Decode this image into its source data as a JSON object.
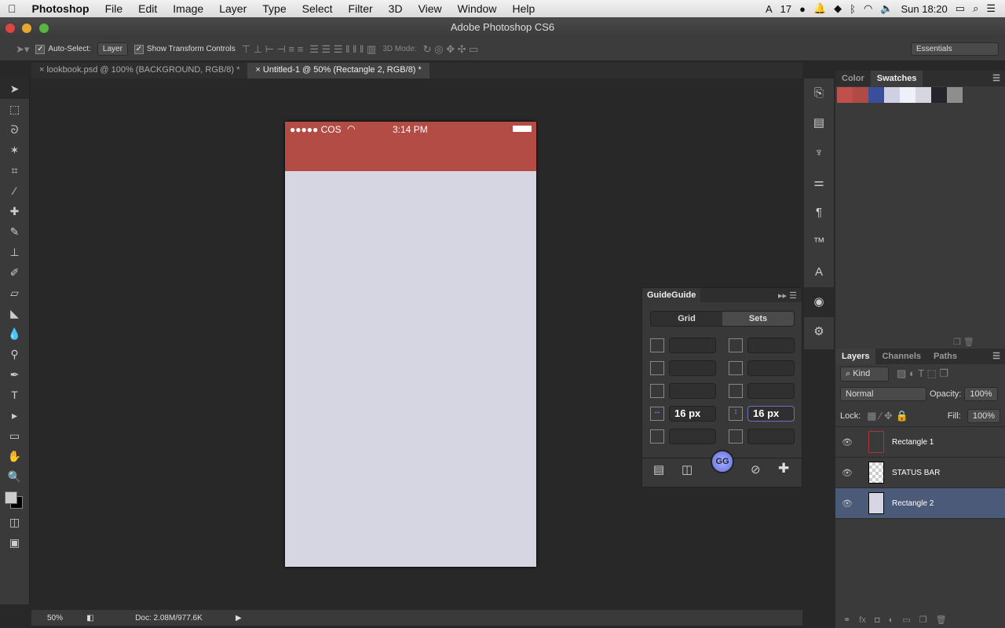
{
  "menubar": {
    "app": "Photoshop",
    "items": [
      "File",
      "Edit",
      "Image",
      "Layer",
      "Type",
      "Select",
      "Filter",
      "3D",
      "View",
      "Window",
      "Help"
    ],
    "status_17": "17",
    "clock": "Sun 18:20"
  },
  "window": {
    "title": "Adobe Photoshop CS6"
  },
  "options": {
    "auto_select": "Auto-Select:",
    "auto_select_value": "Layer",
    "show_transform": "Show Transform Controls",
    "mode_3d": "3D Mode:",
    "workspace": "Essentials"
  },
  "tabs": [
    {
      "label": "lookbook.psd @ 100% (BACKGROUND, RGB/8) *"
    },
    {
      "label": "Untitled-1 @ 50% (Rectangle 2, RGB/8) *"
    }
  ],
  "doc": {
    "carrier": "●●●●● COS",
    "time": "3:14 PM",
    "nav_color": "#b24c45",
    "body_color": "#d6d5e2"
  },
  "status": {
    "zoom": "50%",
    "doc_size": "Doc: 2.08M/977.6K"
  },
  "swatch_panel": {
    "tabs": [
      "Color",
      "Swatches"
    ],
    "swatches": [
      "#c0504a",
      "#b04a45",
      "#3a4f9a",
      "#d0d0e4",
      "#f0f0fa",
      "#d6d6e0",
      "#24242c",
      "#8e8e8e"
    ]
  },
  "guideguide": {
    "title": "GuideGuide",
    "tabs": [
      "Grid",
      "Sets"
    ],
    "col_gutter": "16 px",
    "row_gutter": "16 px",
    "gg": "GG"
  },
  "layers_panel": {
    "tabs": [
      "Layers",
      "Channels",
      "Paths"
    ],
    "filter": "Kind",
    "blend": "Normal",
    "opacity_label": "Opacity:",
    "opacity": "100%",
    "lock_label": "Lock:",
    "fill_label": "Fill:",
    "fill": "100%",
    "layers": [
      {
        "name": "Rectangle 1"
      },
      {
        "name": "STATUS BAR"
      },
      {
        "name": "Rectangle 2"
      }
    ]
  }
}
